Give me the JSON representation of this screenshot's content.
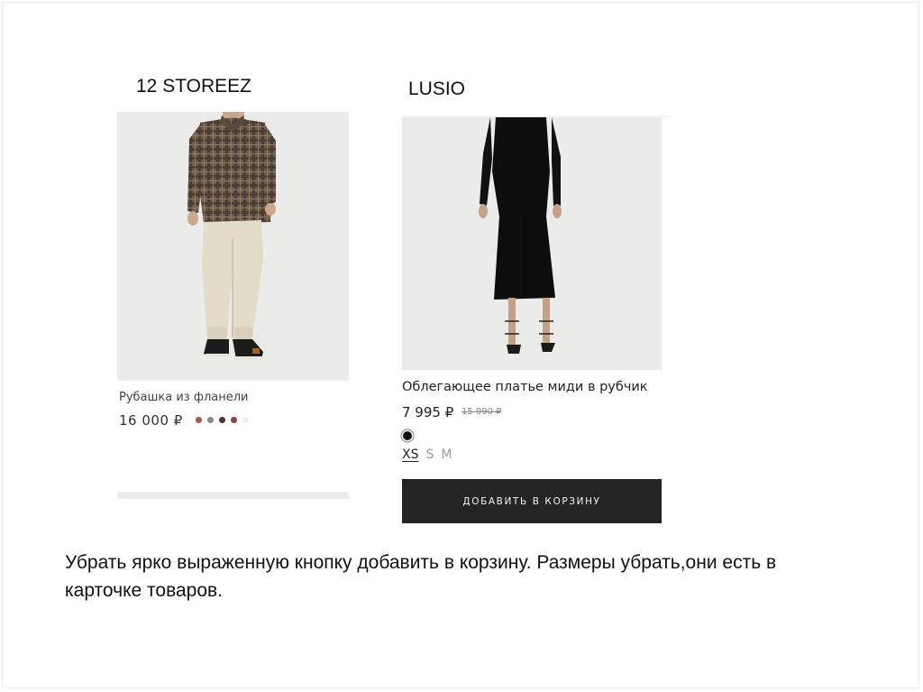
{
  "brands": {
    "left": "12 STOREEZ",
    "right": "LUSIO"
  },
  "left_product": {
    "name": "Рубашка из фланели",
    "price": "16 000 ₽",
    "swatches": [
      "#b8553d",
      "#8a8784",
      "#5a2f2a",
      "#7a4a3e",
      "#efefef"
    ]
  },
  "right_product": {
    "name": "Облегающее платье миди в рубчик",
    "price": "7 995 ₽",
    "old_price": "15 990 ₽",
    "color": "#111111",
    "sizes": [
      "XS",
      "S",
      "M"
    ],
    "selected_size": "XS",
    "cart_button": "ДОБАВИТЬ В КОРЗИНУ"
  },
  "note": "Убрать ярко выраженную кнопку добавить в корзину. Размеры убрать,они есть в карточке товаров."
}
